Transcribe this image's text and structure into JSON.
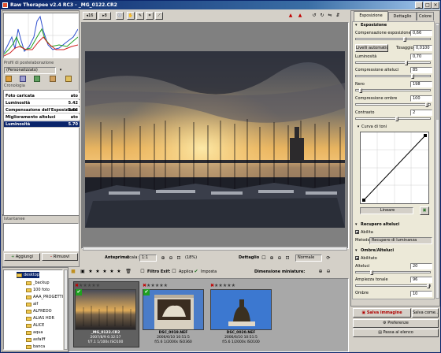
{
  "window": {
    "title": "Raw Therapee v2.4 RC3 - _MG_0122.CR2",
    "min": "_",
    "max": "□",
    "close": "×"
  },
  "colors": {
    "titlebar": "#0a246a",
    "selection": "#0a246a",
    "redButton": "#c00000"
  },
  "left": {
    "profiles_label": "Profil di postelaborazione",
    "profile_value": "(Personalizzato)",
    "history_label": "Cronologia",
    "history": [
      {
        "label": "Foto caricata",
        "value": "ato",
        "bold": true
      },
      {
        "label": "Luminosità",
        "value": "5.42",
        "bold": true
      },
      {
        "label": "Compensazione dell'Esposizione",
        "value": "3.66",
        "bold": true
      },
      {
        "label": "Miglioramento alteluci",
        "value": "ato",
        "bold": true
      },
      {
        "label": "Luminosità",
        "value": "5.70",
        "bold": true,
        "selected": true
      }
    ],
    "snapshots_label": "Istantanee",
    "add_button": "Aggiungi",
    "remove_button": "Rimuovi"
  },
  "toolbar": {
    "zoom_label_a": "16",
    "zoom_label_b": "8"
  },
  "preview": {
    "label": "Anteprima:",
    "scale_label": "Scala:",
    "scale_value": "1:1",
    "zoom_pct": "(18%)",
    "detail_label": "Dettaglio",
    "mode_value": "Normale"
  },
  "filmstrip_bar": {
    "filter_label": "Filtro Exif:",
    "apply_label": "Applica",
    "set_label": "Imposta",
    "thumb_size_label": "Dimensione miniature:"
  },
  "tree": {
    "root": "desktop",
    "items": [
      "_backup",
      "100 foto",
      "AAA_PROGETTI",
      "alf",
      "ALFREDO",
      "ALIAS HDR",
      "ALICE",
      "aqua",
      "asfalff",
      "banca"
    ]
  },
  "thumbs": [
    {
      "name": "_MG_0122.CR2",
      "line2": "2007/8/9 6:32:57",
      "line3": "f/7.1 1/100s ISO100"
    },
    {
      "name": "DSC_0019.NEF",
      "line2": "2006/6/10 10:51:5",
      "line3": "f/5.6 1/2000s ISO360"
    },
    {
      "name": "DSC_0020.NEF",
      "line2": "2006/6/10 10:51:5",
      "line3": "f/5.6 1/2000s ISO100"
    }
  ],
  "right": {
    "tabs": [
      "Esposizione",
      "Dettaglio",
      "Colore"
    ],
    "exposure": {
      "title": "Esposizione",
      "exp_comp_label": "Compensazione esposizione",
      "exp_comp_value": "0,66",
      "auto_levels": "Livelli automatici",
      "clip_label": "Tosaggio",
      "clip_value": "0,0100",
      "brightness_label": "Luminosità",
      "brightness_value": "0,70",
      "highlight_comp_label": "Compressione alteluci",
      "highlight_comp_value": "85",
      "black_label": "Nero",
      "black_value": "198",
      "shadow_comp_label": "Compressione ombre",
      "shadow_comp_value": "100",
      "contrast_label": "Contrasto",
      "contrast_value": "2",
      "curve_label": "Curva di toni",
      "curve_type": "Lineare"
    },
    "highlight_recovery": {
      "title": "Recupero alteluci",
      "enable": "Abilita",
      "method_label": "Metodo:",
      "method_value": "Recupero di luminanza"
    },
    "shadows_highlights": {
      "title": "Ombre/Alteluci",
      "enable": "Abilitato",
      "highlights_label": "Alteluci",
      "highlights_value": "20",
      "tonal_width_label": "Ampiezza tonale",
      "tonal_width_value": "96",
      "shadows_label": "Ombre",
      "shadows_value": "10"
    },
    "save_image": "Salva immagine",
    "save_as": "Salva come...",
    "preferences": "Preferenze",
    "send_to_queue": "Passa al elenco"
  }
}
